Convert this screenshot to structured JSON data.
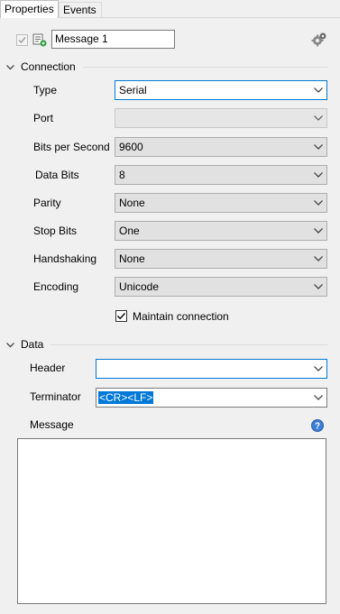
{
  "tabs": [
    {
      "label": "Properties",
      "active": true
    },
    {
      "label": "Events",
      "active": false
    }
  ],
  "header": {
    "name_value": "Message 1",
    "enabled_checked": true
  },
  "sections": {
    "connection": {
      "title": "Connection"
    },
    "data": {
      "title": "Data"
    }
  },
  "connection": {
    "type": {
      "label": "Type",
      "value": "Serial"
    },
    "port": {
      "label": "Port",
      "value": ""
    },
    "bits_per_second": {
      "label": "Bits per Second",
      "value": "9600"
    },
    "data_bits": {
      "label": "Data Bits",
      "value": "8"
    },
    "parity": {
      "label": "Parity",
      "value": "None"
    },
    "stop_bits": {
      "label": "Stop Bits",
      "value": "One"
    },
    "handshaking": {
      "label": "Handshaking",
      "value": "None"
    },
    "encoding": {
      "label": "Encoding",
      "value": "Unicode"
    },
    "maintain_connection": {
      "label": "Maintain connection",
      "checked": true
    }
  },
  "data": {
    "header": {
      "label": "Header",
      "value": ""
    },
    "terminator": {
      "label": "Terminator",
      "value": "<CR><LF>"
    },
    "message": {
      "label": "Message",
      "value": ""
    }
  },
  "colors": {
    "accent": "#0078d7",
    "help_icon": "#3a7fd5"
  },
  "icons": {
    "enabled_check": "checkmark-icon",
    "message_type": "message-icon",
    "settings": "gears-icon",
    "help": "help-icon",
    "dropdown": "chevron-down-icon",
    "collapse": "chevron-down-icon"
  }
}
